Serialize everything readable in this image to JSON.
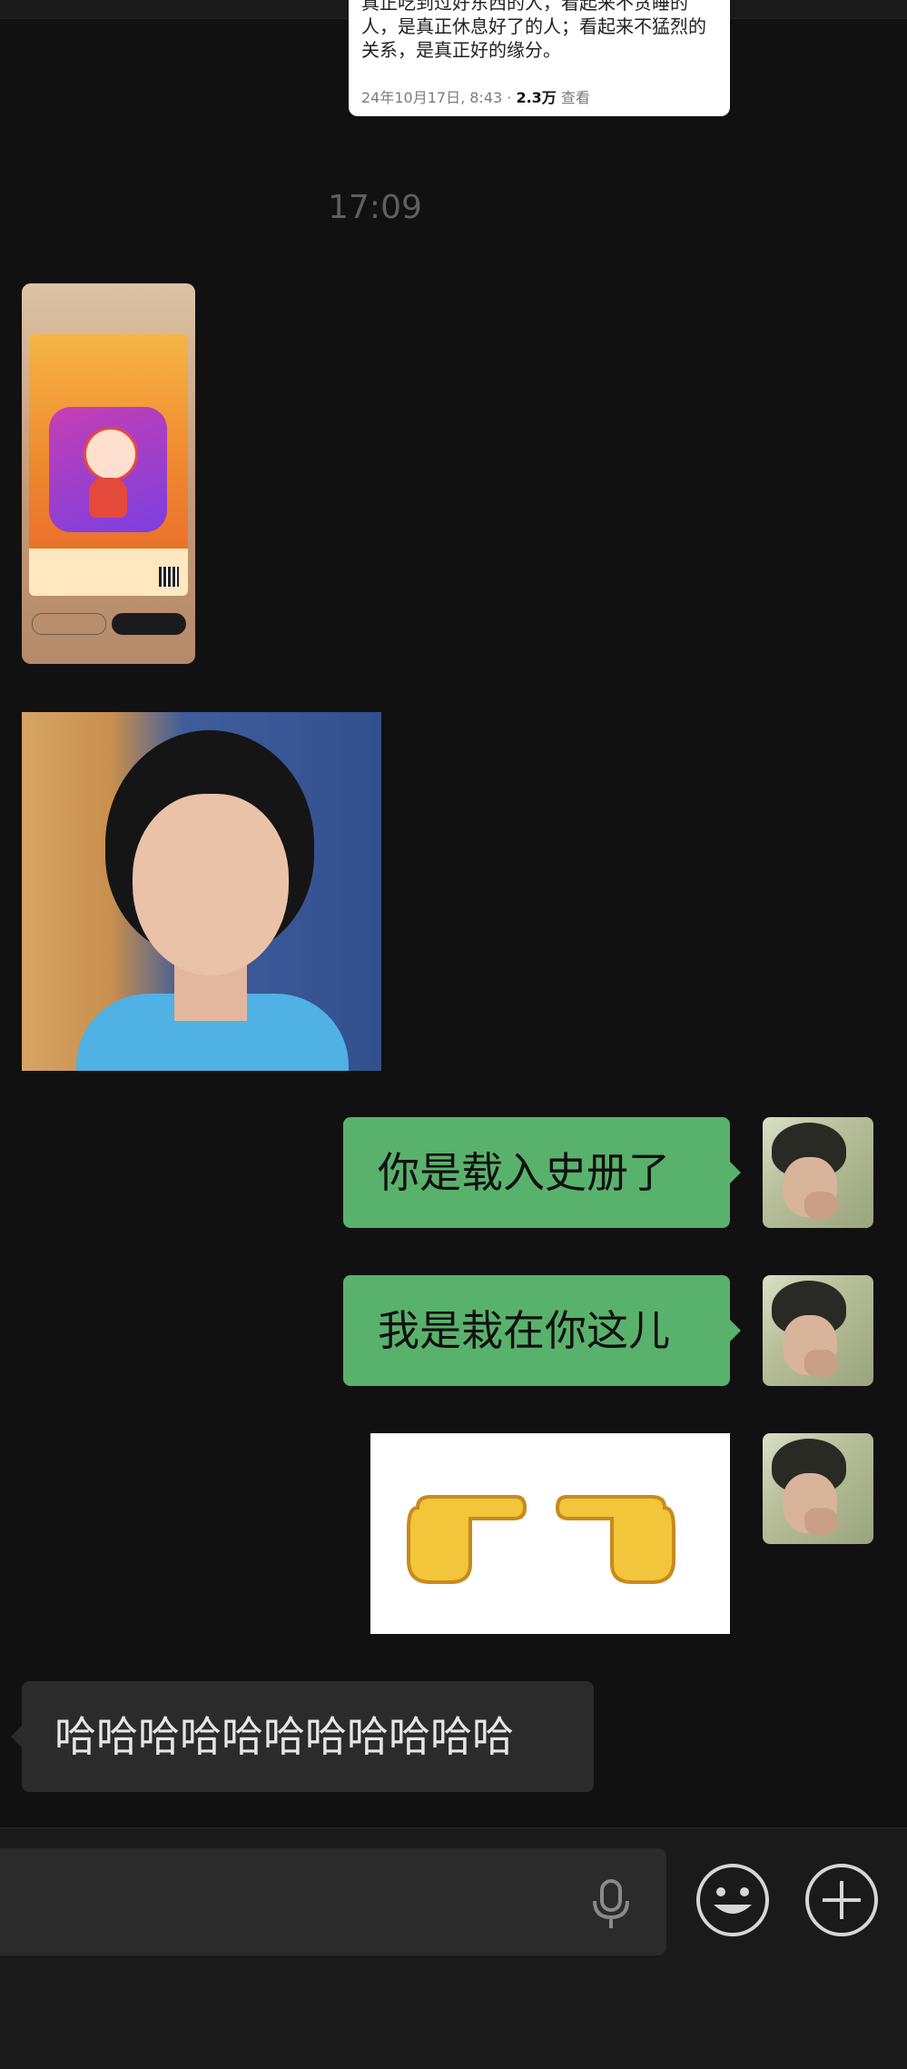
{
  "shared_post": {
    "text": "真正吃到过好东西的人，看起来不贪睡的人，是真正休息好了的人；看起来不猛烈的关系，是真正好的缘分。",
    "date": "24年10月17日, 8:43",
    "separator": " · ",
    "views": "2.3万",
    "view_label": "查看"
  },
  "time_separator": "17:09",
  "messages": {
    "m1_text": "你是载入史册了",
    "m2_text": "我是栽在你这儿",
    "m4_text": "哈哈哈哈哈哈哈哈哈哈哈"
  },
  "colors": {
    "background": "#111111",
    "outgoing_bubble": "#59b26b",
    "incoming_bubble": "#2b2b2b",
    "timestamp": "#5f5f5f"
  },
  "icons": {
    "mic": "microphone-icon",
    "emoji": "emoji-icon",
    "plus": "plus-icon"
  }
}
